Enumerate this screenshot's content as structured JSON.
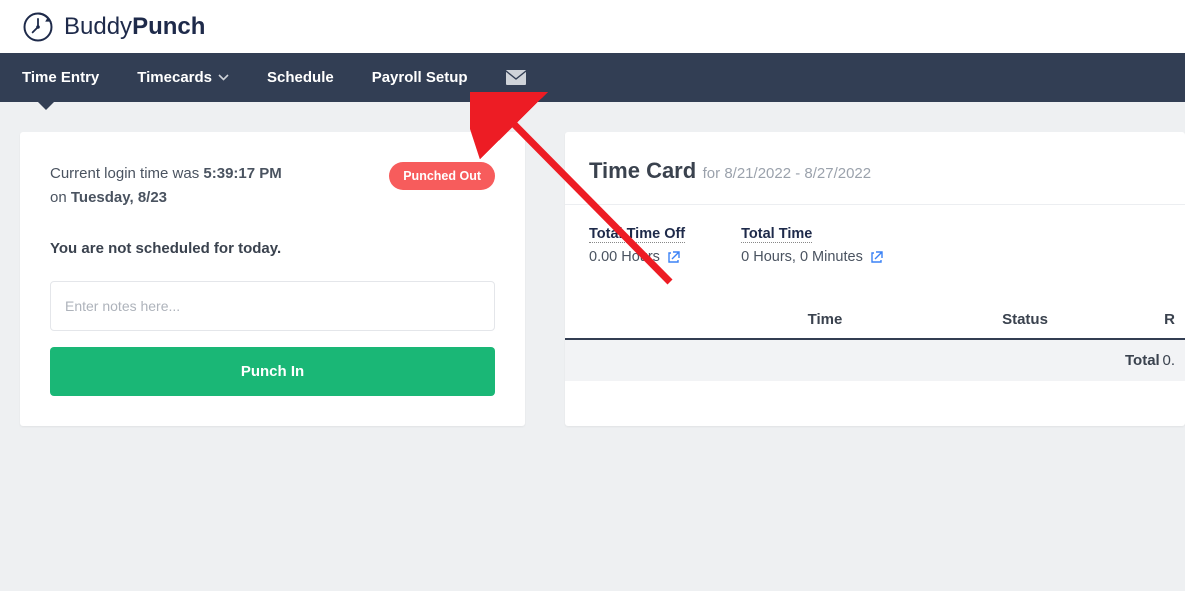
{
  "brand": {
    "name_light": "Buddy",
    "name_bold": "Punch"
  },
  "nav": {
    "time_entry": "Time Entry",
    "timecards": "Timecards",
    "schedule": "Schedule",
    "payroll_setup": "Payroll Setup"
  },
  "left": {
    "login_prefix": "Current login time was ",
    "login_time": "5:39:17 PM",
    "login_on": "on ",
    "login_date": "Tuesday, 8/23",
    "status_badge": "Punched Out",
    "schedule_msg": "You are not scheduled for today.",
    "notes_placeholder": "Enter notes here...",
    "punch_btn": "Punch In"
  },
  "right": {
    "title": "Time Card",
    "range_prefix": "for ",
    "range": "8/21/2022 - 8/27/2022",
    "stats": {
      "time_off_label": "Total Time Off",
      "time_off_value": "0.00 Hours",
      "total_time_label": "Total Time",
      "total_time_value": "0 Hours, 0 Minutes"
    },
    "table": {
      "col_time": "Time",
      "col_status": "Status",
      "col_r": "R",
      "total_label": "Total",
      "total_value": "0."
    }
  }
}
